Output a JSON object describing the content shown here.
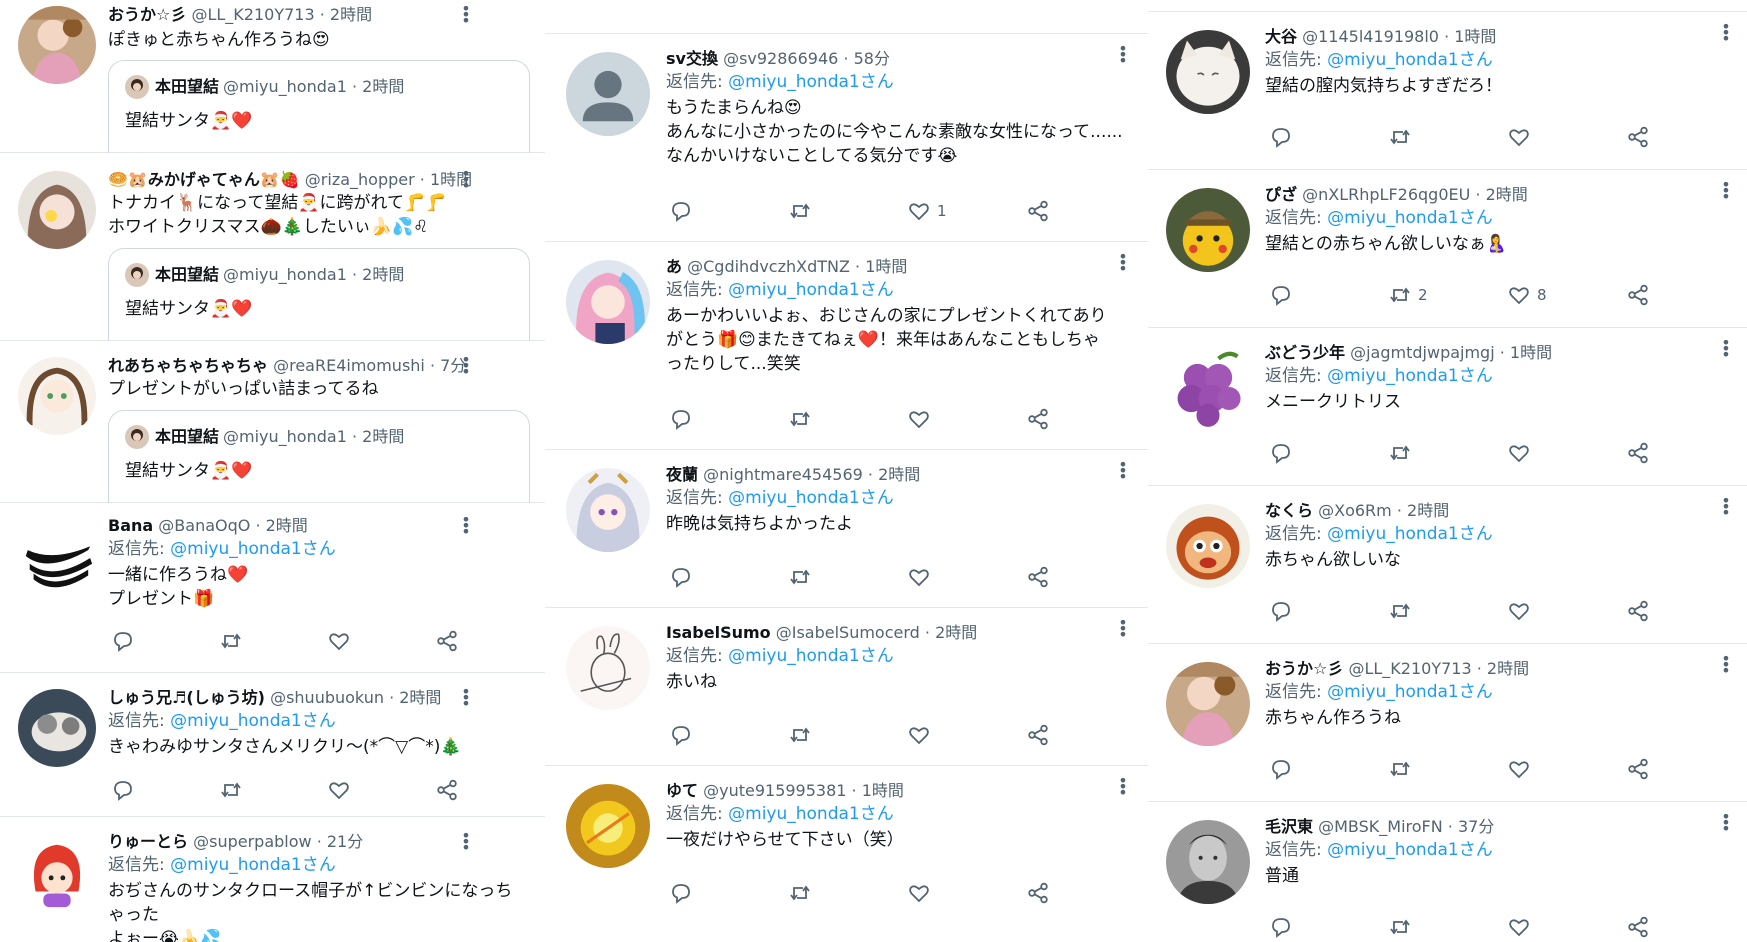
{
  "colors": {
    "link": "#1d9bf0",
    "muted": "#536471",
    "text": "#0f1419"
  },
  "reply_prefix": "返信先:",
  "reply_suffix": "さん",
  "quote": {
    "name": "本田望結",
    "handle": "@miyu_honda1",
    "time": "2時間",
    "text": "望結サンタ🎅❤️"
  },
  "col1": [
    {
      "name": "おうか☆彡",
      "handle": "@LL_K210Y713",
      "time": "2時間",
      "text": "ぽきゅと赤ちゃん作ろうね😍"
    },
    {
      "name": "🥯🐹みかげゃてゃん🐹🍓",
      "handle": "@riza_hopper",
      "time": "1時間",
      "text": "トナカイ🦌になって望結🎅に跨がれて🦵🦵\nホワイトクリスマス🌰🎄したいぃ🍌💦♌"
    },
    {
      "name": "れあちゃちゃちゃちゃ",
      "handle": "@reaRE4imomushi",
      "time": "7分",
      "text": "プレゼントがいっぱい詰まってるね"
    },
    {
      "name": "Bana",
      "handle": "@BanaOqO",
      "time": "2時間",
      "reply_to": "@miyu_honda1",
      "text": "一緒に作ろうね❤️\nプレゼント🎁"
    },
    {
      "name": "しゅう兄♬(しゅう坊)",
      "handle": "@shuubuokun",
      "time": "2時間",
      "reply_to": "@miyu_honda1",
      "text": "きゃわみゆサンタさんメリクリ〜(*⌒▽⌒*)🎄"
    },
    {
      "name": "りゅーとら",
      "handle": "@superpablow",
      "time": "21分",
      "reply_to": "@miyu_honda1",
      "text": "おぢさんのサンタクロース帽子が↑ビンビンになっちゃった\nよぉー😭🍌💦"
    }
  ],
  "col2": [
    {
      "name": "sv交換",
      "handle": "@sv92866946",
      "time": "58分",
      "reply_to": "@miyu_honda1",
      "text": "もうたまらんね😍\nあんなに小さかったのに今やこんな素敵な女性になって......\nなんかいけないことしてる気分です😭",
      "like": "1"
    },
    {
      "name": "あ",
      "handle": "@CgdihdvczhXdTNZ",
      "time": "1時間",
      "reply_to": "@miyu_honda1",
      "text": "あーかわいいよぉ、おじさんの家にプレゼントくれてあり\nがとう🎁😊またきてねぇ❤️！来年はあんなこともしちゃ\nったりして...笑笑"
    },
    {
      "name": "夜蘭",
      "handle": "@nightmare454569",
      "time": "2時間",
      "reply_to": "@miyu_honda1",
      "text": "昨晩は気持ちよかったよ"
    },
    {
      "name": "IsabelSumo",
      "handle": "@IsabelSumocerd",
      "time": "2時間",
      "reply_to": "@miyu_honda1",
      "text": "赤いね"
    },
    {
      "name": "ゆて",
      "handle": "@yute915995381",
      "time": "1時間",
      "reply_to": "@miyu_honda1",
      "text": "一夜だけやらせて下さい（笑）"
    }
  ],
  "col3": [
    {
      "name": "大谷",
      "handle": "@1145l419198l0",
      "time": "1時間",
      "reply_to": "@miyu_honda1",
      "text": "望結の膣内気持ちよすぎだろ！"
    },
    {
      "name": "ぴざ",
      "handle": "@nXLRhpLF26qg0EU",
      "time": "2時間",
      "reply_to": "@miyu_honda1",
      "text": "望結との赤ちゃん欲しいなぁ🤱",
      "retweet": "2",
      "like": "8"
    },
    {
      "name": "ぶどう少年",
      "handle": "@jagmtdjwpajmgj",
      "time": "1時間",
      "reply_to": "@miyu_honda1",
      "text": "メニークリトリス"
    },
    {
      "name": "なくら",
      "handle": "@Xo6Rm",
      "time": "2時間",
      "reply_to": "@miyu_honda1",
      "text": "赤ちゃん欲しいな"
    },
    {
      "name": "おうか☆彡",
      "handle": "@LL_K210Y713",
      "time": "2時間",
      "reply_to": "@miyu_honda1",
      "text": "赤ちゃん作ろうね"
    },
    {
      "name": "毛沢東",
      "handle": "@MBSK_MiroFN",
      "time": "37分",
      "reply_to": "@miyu_honda1",
      "text": "普通"
    }
  ]
}
